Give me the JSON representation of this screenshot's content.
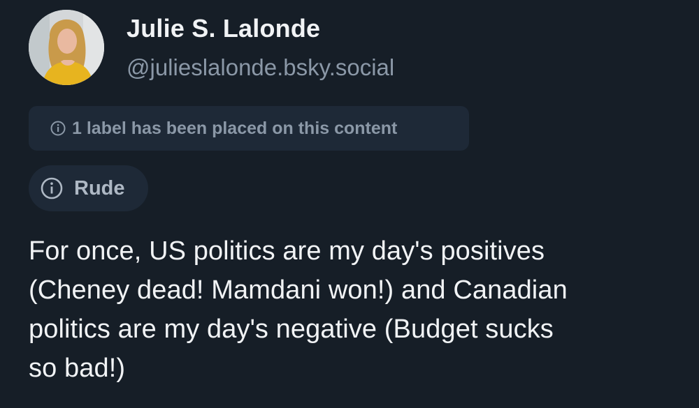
{
  "author": {
    "display_name": "Julie S. Lalonde",
    "handle": "@julieslalonde.bsky.social",
    "avatar_icon": "avatar-photo"
  },
  "moderation": {
    "notice_text": "1 label has been placed on this content",
    "notice_icon": "info-circle-icon",
    "label_text": "Rude",
    "label_icon": "info-circle-icon"
  },
  "post": {
    "lines": [
      "For once, US politics are my day's positives",
      "(Cheney dead! Mamdani won!) and Canadian",
      "politics are my day's negative (Budget sucks",
      "so bad!)"
    ]
  },
  "colors": {
    "background": "#161e27",
    "pill_background": "#1e2937",
    "primary_text": "#f1f3f5",
    "secondary_text": "#8b98a7"
  }
}
